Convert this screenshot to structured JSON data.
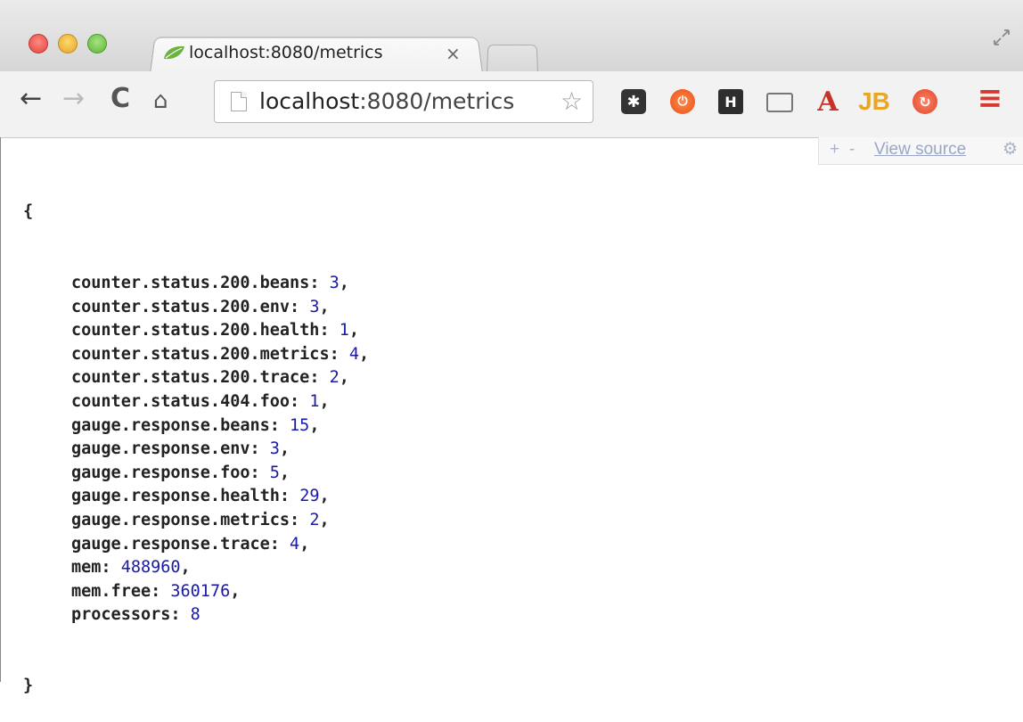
{
  "window": {
    "tab": {
      "title": "localhost:8080/metrics",
      "close_glyph": "×"
    },
    "colors": {
      "spring_leaf": "#6db33f"
    }
  },
  "toolbar": {
    "back_glyph": "←",
    "forward_glyph": "→",
    "reload_glyph": "C",
    "home_glyph": "⌂",
    "url_host": "localhost",
    "url_rest": ":8080/metrics",
    "star_glyph": "☆",
    "extensions": {
      "asterisk": "✱",
      "power": "⏻",
      "h": "H",
      "a": "A",
      "jb": "JB",
      "refresh": "↻",
      "menu": "≡"
    }
  },
  "viewer": {
    "plus": "+",
    "minus": "-",
    "view_source": "View source",
    "gear_glyph": "⚙"
  },
  "json": {
    "open": "{",
    "close": "}",
    "entries": [
      {
        "key": "counter.status.200.beans",
        "value": "3",
        "comma": ","
      },
      {
        "key": "counter.status.200.env",
        "value": "3",
        "comma": ","
      },
      {
        "key": "counter.status.200.health",
        "value": "1",
        "comma": ","
      },
      {
        "key": "counter.status.200.metrics",
        "value": "4",
        "comma": ","
      },
      {
        "key": "counter.status.200.trace",
        "value": "2",
        "comma": ","
      },
      {
        "key": "counter.status.404.foo",
        "value": "1",
        "comma": ","
      },
      {
        "key": "gauge.response.beans",
        "value": "15",
        "comma": ","
      },
      {
        "key": "gauge.response.env",
        "value": "3",
        "comma": ","
      },
      {
        "key": "gauge.response.foo",
        "value": "5",
        "comma": ","
      },
      {
        "key": "gauge.response.health",
        "value": "29",
        "comma": ","
      },
      {
        "key": "gauge.response.metrics",
        "value": "2",
        "comma": ","
      },
      {
        "key": "gauge.response.trace",
        "value": "4",
        "comma": ","
      },
      {
        "key": "mem",
        "value": "488960",
        "comma": ","
      },
      {
        "key": "mem.free",
        "value": "360176",
        "comma": ","
      },
      {
        "key": "processors",
        "value": "8",
        "comma": ""
      }
    ]
  }
}
